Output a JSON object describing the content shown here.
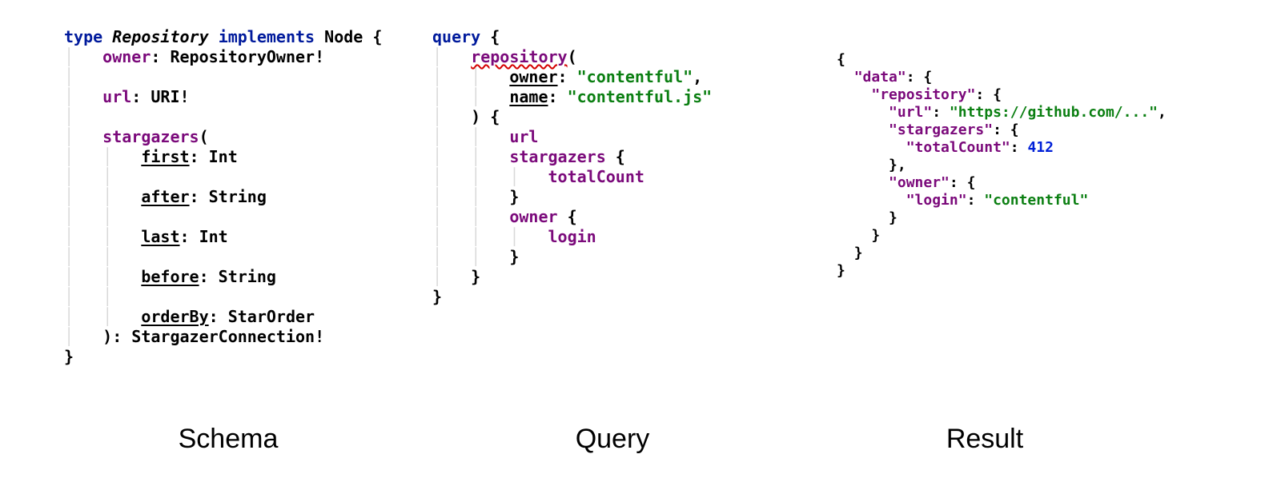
{
  "labels": {
    "schema": "Schema",
    "query": "Query",
    "result": "Result"
  },
  "schema": {
    "l1_type": "type",
    "l1_name": "Repository",
    "l1_impl": "implements",
    "l1_node": "Node {",
    "l2_owner": "owner",
    "l2_ownerType": ": RepositoryOwner!",
    "l3_url": "url",
    "l3_urlType": ": URI!",
    "l4_star": "stargazers",
    "l4_paren": "(",
    "l5_first": "first",
    "l5_firstType": ": Int",
    "l6_after": "after",
    "l6_afterType": ": String",
    "l7_last": "last",
    "l7_lastType": ": Int",
    "l8_before": "before",
    "l8_beforeType": ": String",
    "l9_orderBy": "orderBy",
    "l9_orderByType": ": StarOrder",
    "l10_close": "): StargazerConnection!",
    "l11_brace": "}"
  },
  "query": {
    "l1_query": "query",
    "l1_brace": " {",
    "l2_repo": "repository",
    "l2_paren": "(",
    "l3_owner": "owner",
    "l3_colon": ": ",
    "l3_val": "\"contentful\"",
    "l3_comma": ",",
    "l4_name": "name",
    "l4_colon": ": ",
    "l4_val": "\"contentful.js\"",
    "l5_close": ") {",
    "l6_url": "url",
    "l7_star": "stargazers",
    "l7_brace": " {",
    "l8_total": "totalCount",
    "l9_cbrace": "}",
    "l10_owner": "owner",
    "l10_brace": " {",
    "l11_login": "login",
    "l12_cbrace": "}",
    "l13_cbrace": "}",
    "l14_cbrace": "}"
  },
  "result": {
    "l1": "{",
    "l2_key": "\"data\"",
    "l2_rest": ": {",
    "l3_key": "\"repository\"",
    "l3_rest": ": {",
    "l4_key": "\"url\"",
    "l4_colon": ": ",
    "l4_val": "\"https://github.com/...\"",
    "l4_comma": ",",
    "l5_key": "\"stargazers\"",
    "l5_rest": ": {",
    "l6_key": "\"totalCount\"",
    "l6_colon": ": ",
    "l6_val": "412",
    "l7": "},",
    "l8_key": "\"owner\"",
    "l8_rest": ": {",
    "l9_key": "\"login\"",
    "l9_colon": ": ",
    "l9_val": "\"contentful\"",
    "l10": "}",
    "l11": "}",
    "l12": "}",
    "l13": "}"
  }
}
